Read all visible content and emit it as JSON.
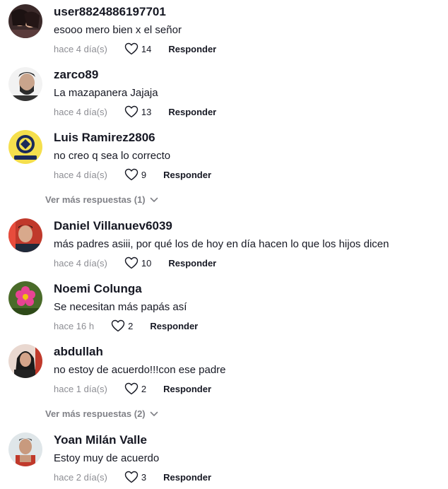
{
  "comments": [
    {
      "username": "user8824886197701",
      "text": "esooo mero bien x el señor",
      "time": "hace 4 día(s)",
      "likes": "14",
      "reply_label": "Responder"
    },
    {
      "username": "zarco89",
      "text": "La mazapanera Jajaja",
      "time": "hace 4 día(s)",
      "likes": "13",
      "reply_label": "Responder"
    },
    {
      "username": "Luis Ramirez2806",
      "text": "no creo q sea lo correcto",
      "time": "hace 4 día(s)",
      "likes": "9",
      "reply_label": "Responder"
    },
    {
      "username": "Daniel Villanuev6039",
      "text": "más padres asiii, por qué los de hoy en día hacen lo que los hijos dicen",
      "time": "hace 4 día(s)",
      "likes": "10",
      "reply_label": "Responder"
    },
    {
      "username": "Noemi Colunga",
      "text": "Se necesitan más papás así",
      "time": "hace 16 h",
      "likes": "2",
      "reply_label": "Responder"
    },
    {
      "username": "abdullah",
      "text": "no estoy de acuerdo!!!con ese padre",
      "time": "hace 1 día(s)",
      "likes": "2",
      "reply_label": "Responder"
    },
    {
      "username": "Yoan Milán Valle",
      "text": "Estoy muy de acuerdo",
      "time": "hace 2 día(s)",
      "likes": "3",
      "reply_label": "Responder"
    }
  ],
  "more_replies": [
    {
      "label": "Ver más respuestas (1)"
    },
    {
      "label": "Ver más respuestas (2)"
    }
  ],
  "icons": {
    "like": "heart-outline-icon",
    "expand": "chevron-down-icon"
  },
  "colors": {
    "text": "#161823",
    "muted": "rgba(22,24,35,0.5)",
    "background": "#ffffff"
  }
}
